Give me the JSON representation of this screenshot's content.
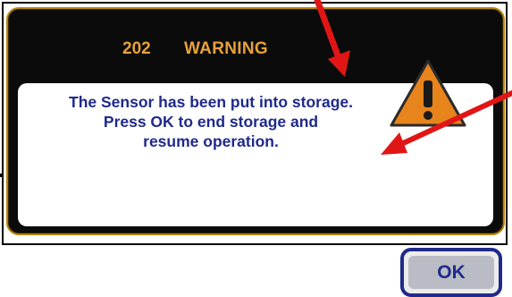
{
  "dialog": {
    "code": "202",
    "title": "WARNING",
    "message_lines": [
      "The Sensor has been put into storage.",
      "Press OK to end storage and",
      "resume operation."
    ],
    "ok_label": "OK",
    "icon": "warning-triangle-icon"
  },
  "annotations": {
    "arrow_color": "#e01616",
    "arrows": [
      "annotation-arrow-top",
      "annotation-arrow-right"
    ]
  },
  "colors": {
    "header_text": "#e8a13a",
    "message_text": "#1f2a8a",
    "dialog_background": "#0b0b0b",
    "dialog_border": "#b8860b",
    "warning_fill": "#e8841c"
  }
}
